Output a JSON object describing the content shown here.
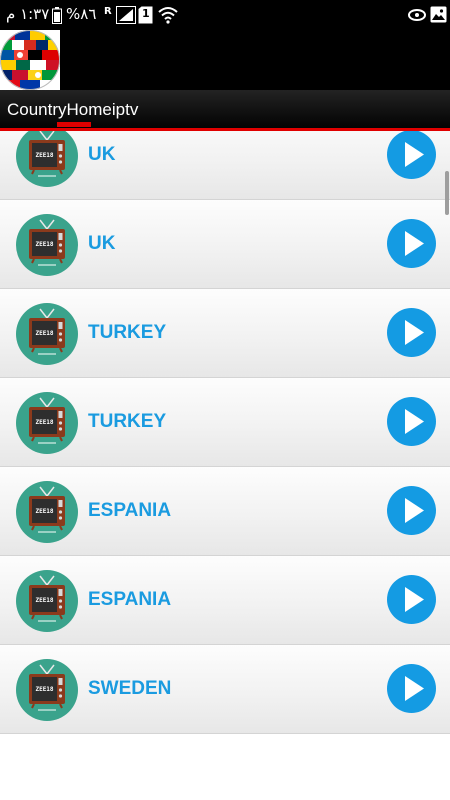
{
  "status_bar": {
    "time": "١:٣٧ م",
    "battery": "%٨٦",
    "sim": "1",
    "network": "R"
  },
  "app_bar": {
    "logo_icon": "world-flags-globe-icon"
  },
  "tabs": [
    {
      "label": "CountryHomeiptv",
      "selected": true
    }
  ],
  "colors": {
    "accent": "#e00000",
    "country_text": "#1a9be0",
    "play_button": "#149be3",
    "bar_background": "#000000"
  },
  "channels": [
    {
      "country": "UK"
    },
    {
      "country": "UK"
    },
    {
      "country": "TURKEY"
    },
    {
      "country": "TURKEY"
    },
    {
      "country": "ESPANIA"
    },
    {
      "country": "ESPANIA"
    },
    {
      "country": "SWEDEN"
    }
  ]
}
